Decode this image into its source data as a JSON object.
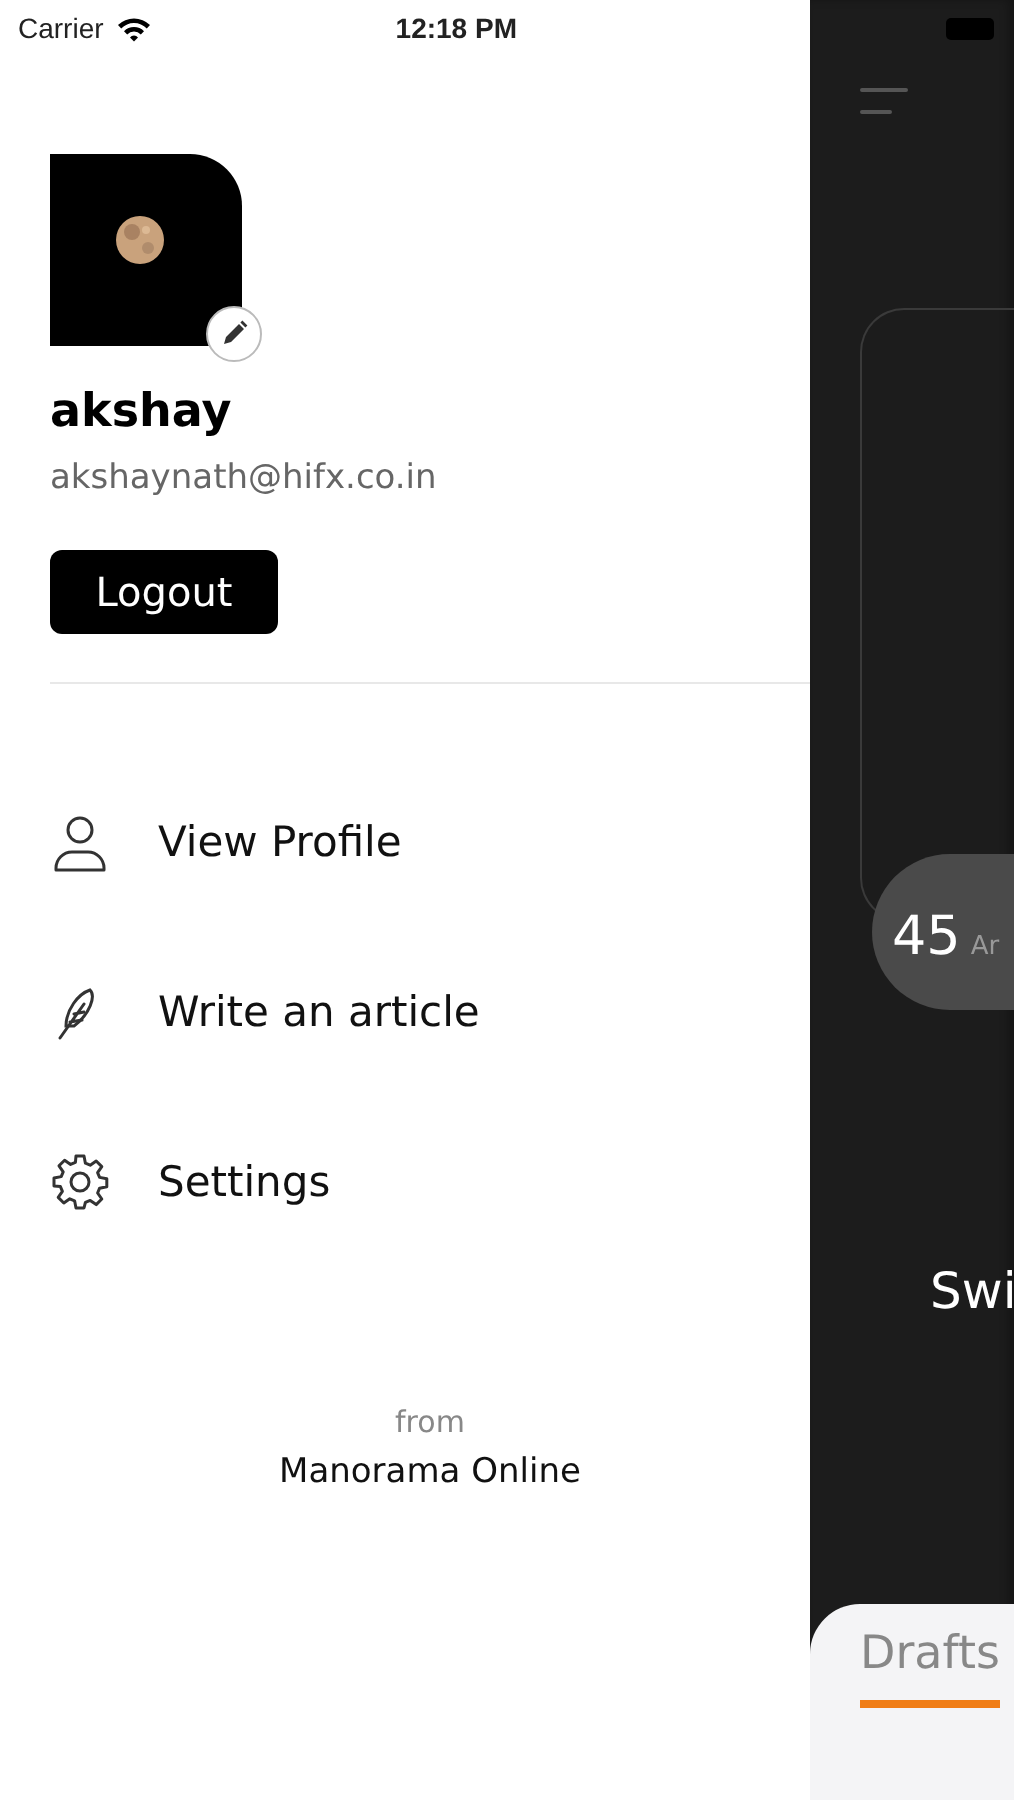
{
  "status_bar": {
    "carrier": "Carrier",
    "time": "12:18 PM"
  },
  "profile": {
    "name": "akshay",
    "email": "akshaynath@hifx.co.in",
    "logout": "Logout"
  },
  "menu": [
    {
      "kind": "profile",
      "label": "View Profile"
    },
    {
      "kind": "write",
      "label": "Write an article"
    },
    {
      "kind": "settings",
      "label": "Settings"
    }
  ],
  "footer": {
    "from": "from",
    "brand": "Manorama Online"
  },
  "background_screen": {
    "count": "45",
    "count_label": "Ar",
    "heading": "Swi",
    "tabs": [
      {
        "label": "Drafts",
        "selected": true
      }
    ]
  }
}
